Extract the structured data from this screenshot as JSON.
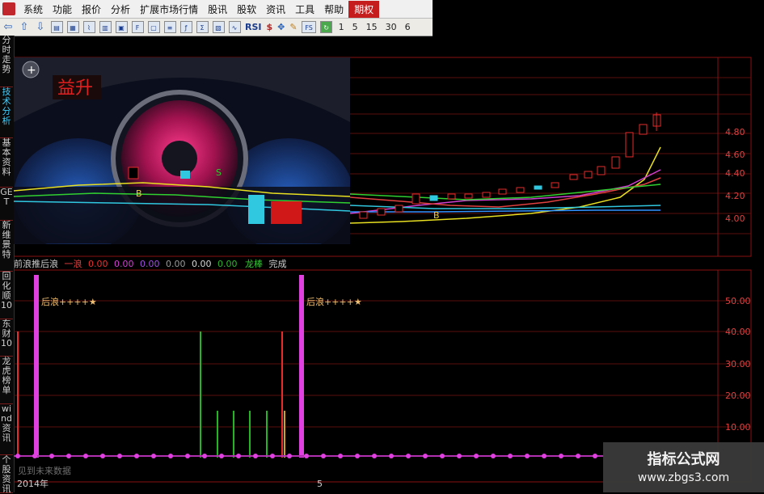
{
  "menu": {
    "items": [
      "系统",
      "功能",
      "报价",
      "分析",
      "扩展市场行情",
      "股讯",
      "股软",
      "资讯",
      "工具",
      "帮助",
      "期权"
    ]
  },
  "toolbar": {
    "labels": {
      "rsi": "RSI",
      "fs": "FS"
    },
    "periods": [
      "1",
      "5",
      "15",
      "30",
      "6"
    ]
  },
  "sidebar": {
    "tabs": [
      "分时走势",
      "技术分析",
      "基本资料",
      "GET",
      "新维景特",
      "回化顺10",
      "东财10",
      "龙虎榜单",
      "wind资讯",
      "个股资讯"
    ]
  },
  "upper_panel": {
    "logo_text": "益升",
    "price_ticks": [
      "4.80",
      "4.60",
      "4.40",
      "4.20",
      "4.00"
    ],
    "b_marker": "B",
    "s_marker": "S"
  },
  "indicator_bar": {
    "title": "前浪推后浪",
    "values": [
      "0.00",
      "0.00",
      "0.00",
      "0.00",
      "0.00",
      "0.00"
    ],
    "value_colors": [
      "#e83030",
      "#d040d0",
      "#a050e0",
      "#cfcfcf",
      "#d6d6d6",
      "#2fb42f"
    ],
    "right_labels": [
      "一浪",
      "龙棒",
      "完成"
    ]
  },
  "lower_panel": {
    "annotations": [
      "后浪++++★",
      "后浪++++★"
    ],
    "ticks": [
      "50.00",
      "40.00",
      "30.00",
      "20.00",
      "10.00"
    ],
    "footer_text": "见到未来数据",
    "x_labels": [
      "2014年",
      "5"
    ]
  },
  "watermark": {
    "line1": "指标公式网",
    "line2": "www.zbgs3.com"
  },
  "colors": {
    "up_red": "#e82a2a",
    "magenta": "#e040e0",
    "green": "#24b424",
    "grid_red": "#a01212"
  }
}
